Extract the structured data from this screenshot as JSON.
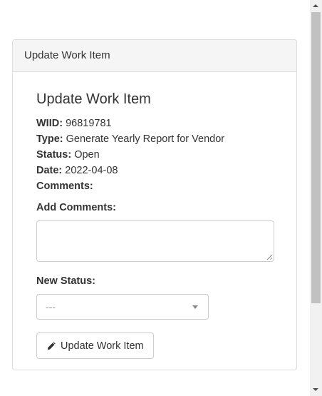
{
  "panel": {
    "heading": "Update Work Item",
    "title": "Update Work Item"
  },
  "info": {
    "wiid_label": "WIID:",
    "wiid_value": "96819781",
    "type_label": "Type:",
    "type_value": "Generate Yearly Report for Vendor",
    "status_label": "Status:",
    "status_value": "Open",
    "date_label": "Date:",
    "date_value": "2022-04-08",
    "comments_label": "Comments:"
  },
  "form": {
    "add_comments_label": "Add Comments:",
    "comments_value": "",
    "new_status_label": "New Status:",
    "new_status_selected": "---",
    "submit_label": "Update Work Item",
    "submit_icon": "pencil-icon"
  }
}
